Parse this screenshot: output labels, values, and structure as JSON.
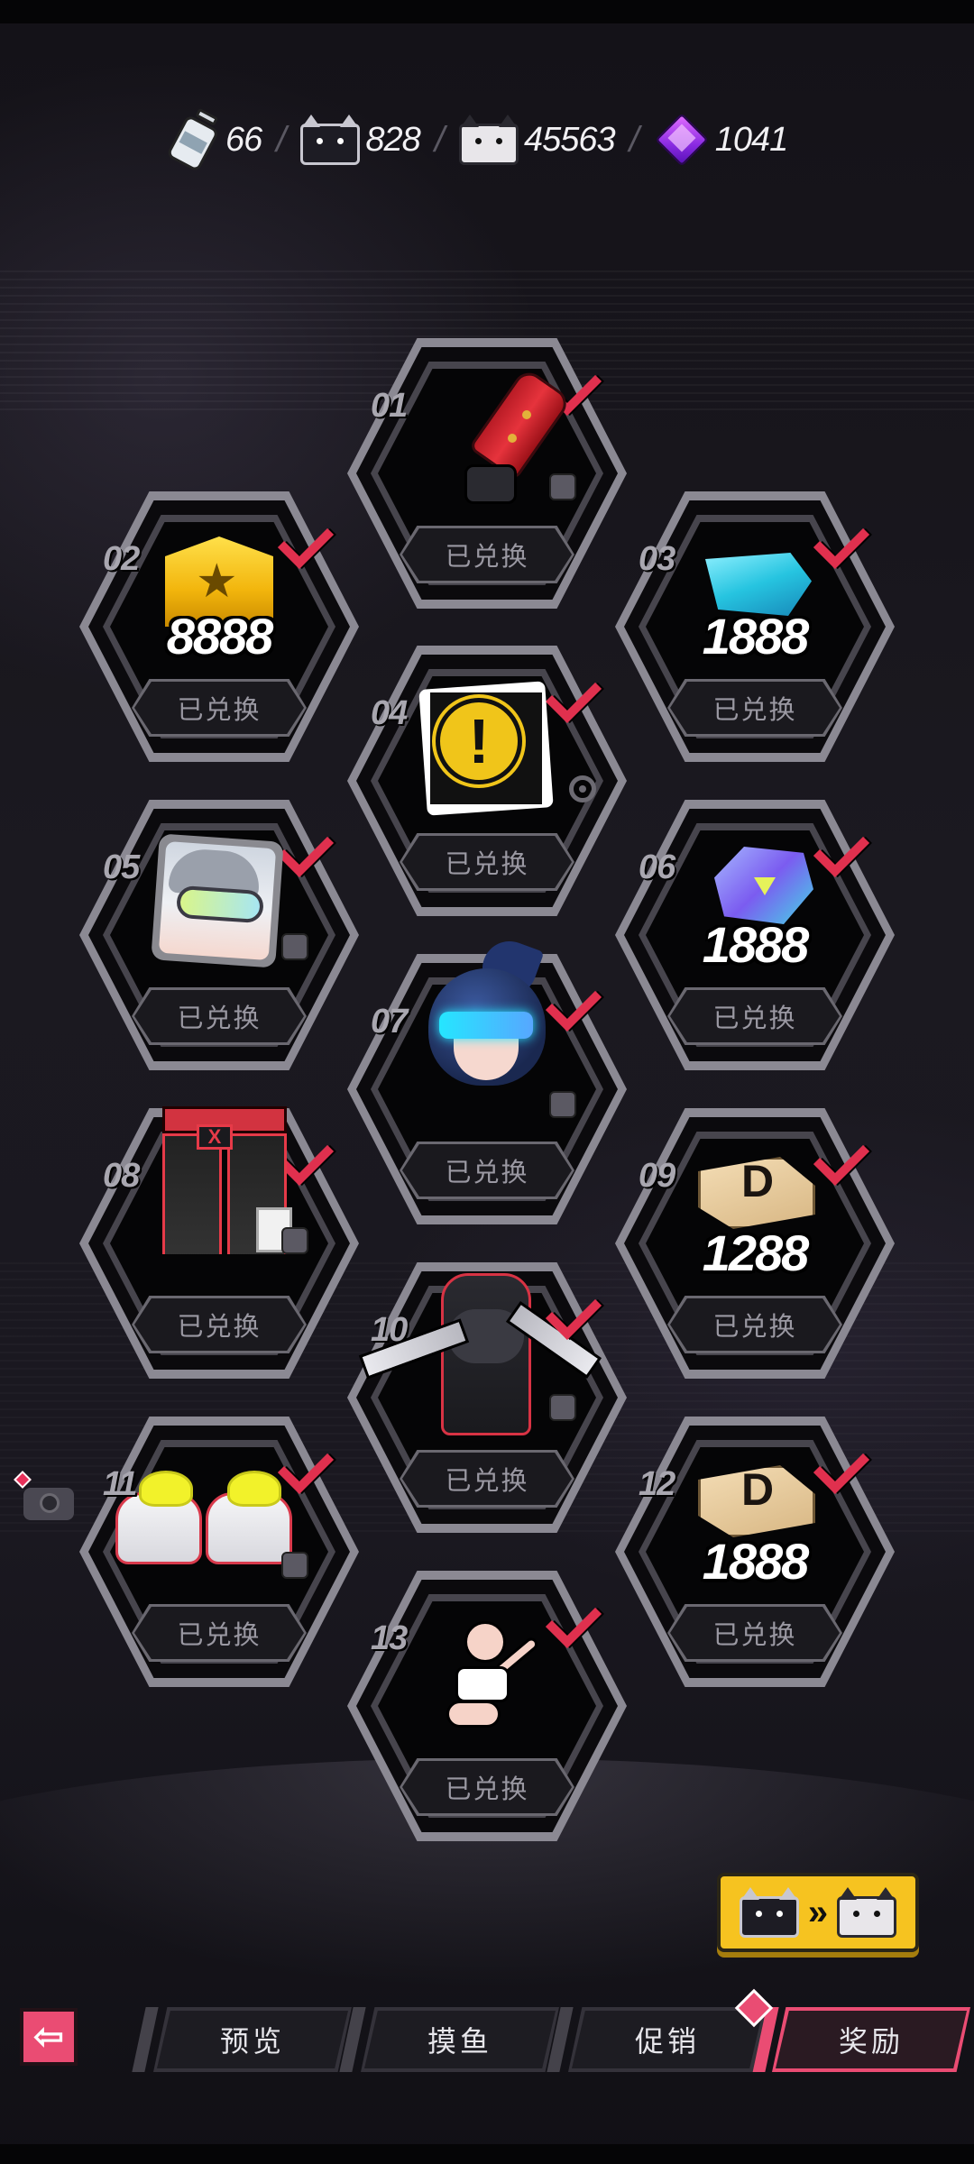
{
  "currencies": [
    {
      "icon": "bottle-icon",
      "value": "66"
    },
    {
      "icon": "dark-cat-icon",
      "value": "828"
    },
    {
      "icon": "light-cat-icon",
      "value": "45563"
    },
    {
      "icon": "purple-cube-icon",
      "value": "1041"
    }
  ],
  "currency_separator": "/",
  "redeemed_label": "已兑换",
  "rewards": [
    {
      "num": "01",
      "icon": "red-glove-icon",
      "amount": "",
      "type_icon": "glove-type-icon"
    },
    {
      "num": "02",
      "icon": "gold-badge-icon",
      "amount": "8888",
      "type_icon": ""
    },
    {
      "num": "03",
      "icon": "blue-gem-icon",
      "amount": "1888",
      "type_icon": ""
    },
    {
      "num": "04",
      "icon": "warning-sign-icon",
      "amount": "",
      "type_icon": "circle-type-icon"
    },
    {
      "num": "05",
      "icon": "avatar-portrait-icon",
      "amount": "",
      "type_icon": "avatar-type-icon"
    },
    {
      "num": "06",
      "icon": "crystal-icon",
      "amount": "1888",
      "type_icon": ""
    },
    {
      "num": "07",
      "icon": "hairstyle-icon",
      "amount": "",
      "type_icon": "hat-type-icon"
    },
    {
      "num": "08",
      "icon": "pants-icon",
      "amount": "",
      "type_icon": "pants-type-icon"
    },
    {
      "num": "09",
      "icon": "ticket-icon",
      "amount": "1288",
      "type_icon": ""
    },
    {
      "num": "10",
      "icon": "outfit-icon",
      "amount": "",
      "type_icon": "shirt-type-icon"
    },
    {
      "num": "11",
      "icon": "shoes-icon",
      "amount": "",
      "type_icon": "shoe-type-icon"
    },
    {
      "num": "12",
      "icon": "ticket-icon",
      "amount": "1888",
      "type_icon": ""
    },
    {
      "num": "13",
      "icon": "pose-icon",
      "amount": "",
      "type_icon": ""
    }
  ],
  "convert_button": {
    "arrow": "»"
  },
  "back_button": {
    "icon": "back-arrow-icon",
    "glyph": "⇦"
  },
  "tabs": [
    {
      "label": "预览",
      "active": false
    },
    {
      "label": "摸鱼",
      "active": false
    },
    {
      "label": "促销",
      "active": false
    },
    {
      "label": "奖励",
      "active": true
    }
  ],
  "colors": {
    "accent_pink": "#ea4c73",
    "check_red": "#e0304e",
    "convert_yellow": "#f6c320"
  }
}
